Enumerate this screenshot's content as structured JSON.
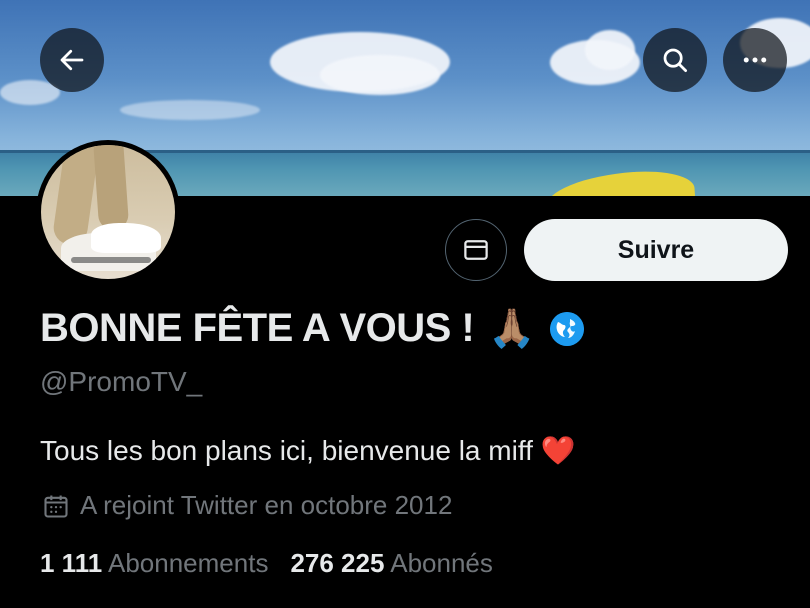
{
  "profile": {
    "display_name": "BONNE FÊTE A VOUS !",
    "name_emoji": "🙏🏽",
    "handle": "@PromoTV_",
    "bio_text": "Tous les bon plans ici, bienvenue la miff",
    "bio_emoji": "❤️",
    "joined": "A rejoint Twitter en octobre 2012",
    "following_count": "1 111",
    "following_label": "Abonnements",
    "followers_count": "276 225",
    "followers_label": "Abonnés"
  },
  "actions": {
    "follow_label": "Suivre"
  },
  "icons": {
    "back": "arrow-left-icon",
    "search": "search-icon",
    "more": "more-icon",
    "message": "envelope-icon",
    "calendar": "calendar-icon",
    "globe": "globe-icon"
  },
  "colors": {
    "background": "#000000",
    "follow_button_bg": "#eff3f4",
    "secondary_text": "#71767b",
    "accent": "#1d9bf0"
  }
}
